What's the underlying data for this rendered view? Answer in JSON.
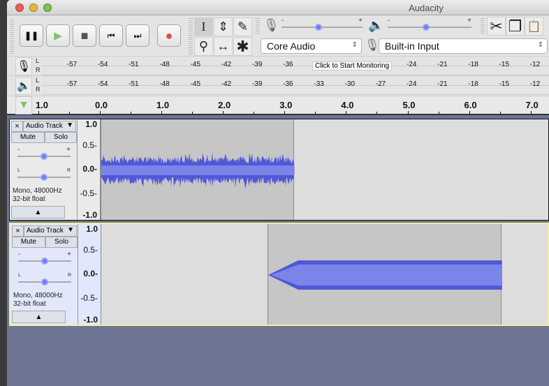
{
  "window": {
    "title": "Audacity"
  },
  "transport": {
    "buttons": [
      {
        "name": "pause-button",
        "icon": "pause-icon",
        "glyph": "❚❚"
      },
      {
        "name": "play-button",
        "icon": "play-icon",
        "glyph": "▶"
      },
      {
        "name": "stop-button",
        "icon": "stop-icon",
        "glyph": "■"
      },
      {
        "name": "skip-start-button",
        "icon": "skip-start-icon",
        "glyph": "⏮"
      },
      {
        "name": "skip-end-button",
        "icon": "skip-end-icon",
        "glyph": "⏭"
      },
      {
        "name": "record-button",
        "icon": "record-icon",
        "glyph": "●"
      }
    ]
  },
  "tools": {
    "selection": "I",
    "envelope": "⇕",
    "draw": "✎",
    "zoom": "⚲",
    "timeshift": "↔",
    "multi": "✱"
  },
  "mixer": {
    "rec_minus": "-",
    "rec_plus": "+",
    "play_minus": "-",
    "play_plus": "+",
    "rec_volume": 0.5,
    "play_volume": 0.5
  },
  "edit": {
    "cut": "✂",
    "copy": "❐",
    "paste": "📋"
  },
  "devices": {
    "host": "Core Audio",
    "input": "Built-in Input"
  },
  "meters": {
    "left": "L",
    "right": "R",
    "record_ticks": [
      "-57",
      "-54",
      "-51",
      "-48",
      "-45",
      "-42",
      "-39",
      "-36",
      "",
      "",
      "",
      "-24",
      "-21",
      "-18",
      "-15",
      "-12"
    ],
    "monitor_hint": "Click to Start Monitoring",
    "play_ticks": [
      "-57",
      "-54",
      "-51",
      "-48",
      "-45",
      "-42",
      "-39",
      "-36",
      "-33",
      "-30",
      "-27",
      "-24",
      "-21",
      "-18",
      "-15",
      "-12"
    ]
  },
  "timeline": {
    "labels": [
      "1.0",
      "0.0",
      "1.0",
      "2.0",
      "3.0",
      "4.0",
      "5.0",
      "6.0",
      "7.0"
    ]
  },
  "tracks": [
    {
      "name": "Audio Track",
      "close": "×",
      "mute": "Mute",
      "solo": "Solo",
      "gain_minus": "-",
      "gain_plus": "+",
      "pan_l": "L",
      "pan_r": "R",
      "info1": "Mono, 48000Hz",
      "info2": "32-bit float",
      "collapse": "▲",
      "ruler": [
        "1.0",
        "0.5-",
        "0.0-",
        "-0.5-",
        "-1.0"
      ],
      "clip_start_s": 0,
      "clip_end_s": 3.14,
      "selected": false
    },
    {
      "name": "Audio Track",
      "close": "×",
      "mute": "Mute",
      "solo": "Solo",
      "gain_minus": "-",
      "gain_plus": "+",
      "pan_l": "L",
      "pan_r": "R",
      "info1": "Mono, 48000Hz",
      "info2": "32-bit float",
      "collapse": "▲",
      "ruler": [
        "1.0",
        "0.5-",
        "0.0-",
        "-0.5-",
        "-1.0"
      ],
      "clip_start_s": 2.7,
      "clip_end_s": 6.5,
      "selected": true
    }
  ],
  "colors": {
    "wave": "#5058d8",
    "wave_rms": "#7b84e8",
    "selected_border": "#f2f0a0",
    "background": "#6f7594"
  }
}
